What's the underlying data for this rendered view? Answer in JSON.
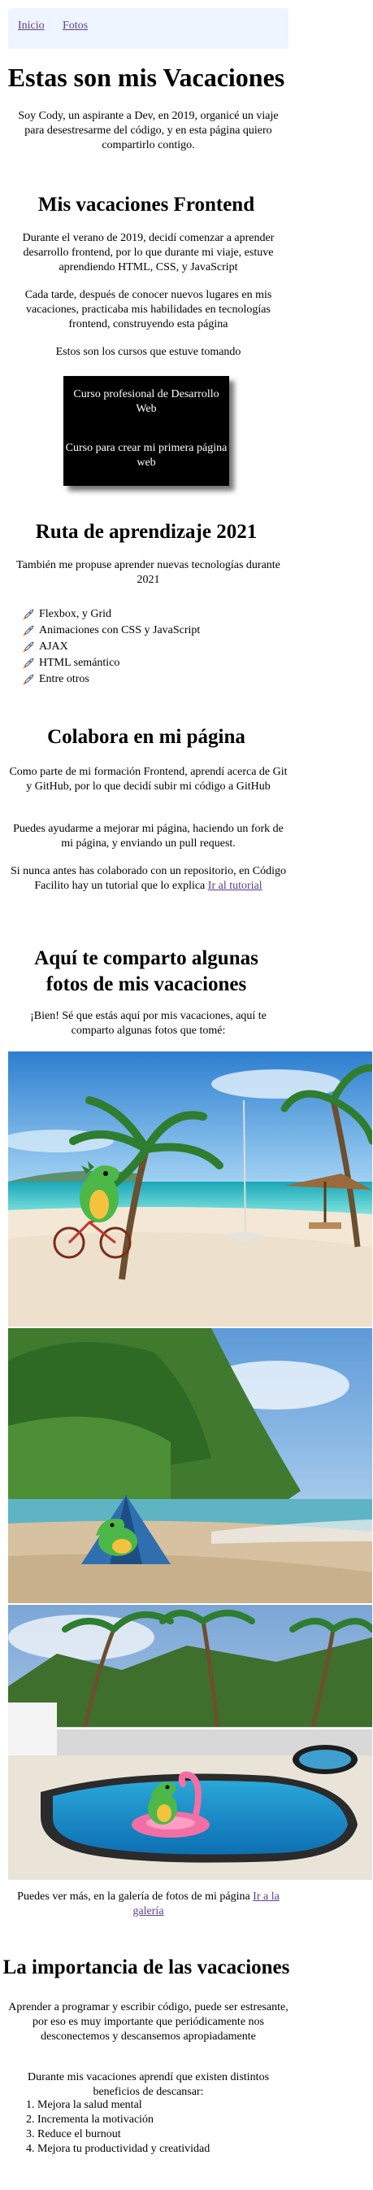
{
  "nav": {
    "home": "Inicio",
    "photos": "Fotos"
  },
  "header": {
    "title": "Estas son mis Vacaciones",
    "intro": "Soy Cody, un aspirante a Dev, en 2019, organicé un viaje para desestresarme del código, y en esta página quiero compartirlo contigo."
  },
  "frontend": {
    "title": "Mis vacaciones Frontend",
    "p1": "Durante el verano de 2019, decidí comenzar a aprender desarrollo frontend, por lo que durante mi viaje, estuve aprendiendo HTML, CSS, y JavaScript",
    "p2": "Cada tarde, después de conocer nuevos lugares en mis vacaciones, practicaba mis habilidades en tecnologías frontend, construyendo esta página",
    "p3": "Estos son los cursos que estuve tomando",
    "courses": [
      "Curso profesional de Desarrollo Web",
      "Curso para crear mi primera página web"
    ]
  },
  "path": {
    "title": "Ruta de aprendizaje 2021",
    "intro": "También me propuse aprender nuevas tecnologías durante 2021",
    "topics": [
      "Flexbox, y Grid",
      "Animaciones con CSS y JavaScript",
      "AJAX",
      "HTML semántico",
      "Entre otros"
    ],
    "bullet_icon": "rocket-icon"
  },
  "collab": {
    "title": "Colabora en mi página",
    "p1": "Como parte de mi formación Frontend, aprendí acerca de Git y GitHub, por lo que decidí subir mi código a GitHub",
    "p2": "Puedes ayudarme a mejorar mi página, haciendo un fork de mi página, y enviando un pull request.",
    "p3_text": "Si nunca antes has colaborado con un repositorio, en Código Facilito hay un tutorial que lo explica ",
    "p3_link": "Ir al tutorial"
  },
  "gallery": {
    "title": "Aquí te comparto algunas fotos de mis vacaciones",
    "intro": "¡Bien! Sé que estás aquí por mis vacaciones, aquí te comparto algunas fotos que tomé:",
    "photos": [
      "beach-bike-photo",
      "beach-tent-photo",
      "pool-float-photo"
    ],
    "more_text": "Puedes ver más, en la galería de fotos de mi página ",
    "more_link": "Ir a la galería"
  },
  "importance": {
    "title": "La importancia de las vacaciones",
    "p1": "Aprender a programar y escribir código, puede ser estresante, por eso es muy importante que periódicamente nos desconectemos y descansemos apropiadamente",
    "p2": "Durante mis vacaciones aprendí que existen distintos beneficios de descansar:",
    "benefits": [
      "Mejora la salud mental",
      "Incrementa la motivación",
      "Reduce el burnout",
      "Mejora tu productividad y creatividad"
    ]
  },
  "colors": {
    "link": "#5a3e8e",
    "nav_bg": "#eef5ff",
    "course_bg": "#000000"
  }
}
